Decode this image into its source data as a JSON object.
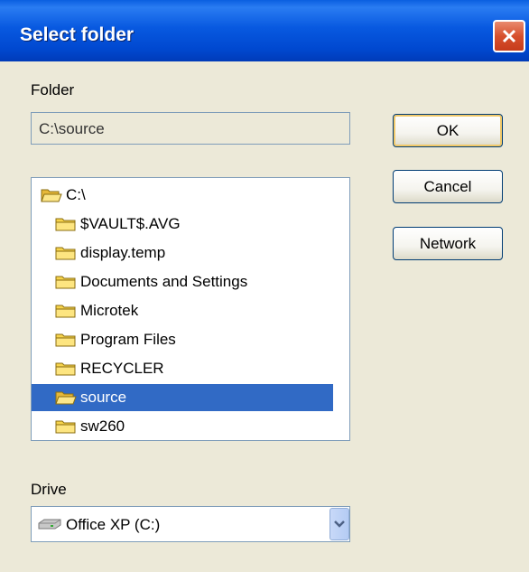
{
  "window": {
    "title": "Select folder"
  },
  "folder": {
    "label": "Folder",
    "value": "C:\\source"
  },
  "buttons": {
    "ok": "OK",
    "cancel": "Cancel",
    "network": "Network"
  },
  "tree": {
    "items": [
      {
        "label": "C:\\",
        "state": "open",
        "selected": false
      },
      {
        "label": "$VAULT$.AVG",
        "state": "closed",
        "selected": false
      },
      {
        "label": "display.temp",
        "state": "closed",
        "selected": false
      },
      {
        "label": "Documents and Settings",
        "state": "closed",
        "selected": false
      },
      {
        "label": "Microtek",
        "state": "closed",
        "selected": false
      },
      {
        "label": "Program Files",
        "state": "closed",
        "selected": false
      },
      {
        "label": "RECYCLER",
        "state": "closed",
        "selected": false
      },
      {
        "label": "source",
        "state": "open",
        "selected": true
      },
      {
        "label": "sw260",
        "state": "closed",
        "selected": false
      }
    ]
  },
  "drive": {
    "label": "Drive",
    "value": "Office XP (C:)"
  },
  "colors": {
    "titlebar": "#0859e0",
    "selection": "#316ac5",
    "dialog_bg": "#ece9d8",
    "close": "#d7502d"
  },
  "icons": {
    "close": "close-icon",
    "folder": "folder-icon",
    "drive": "drive-icon"
  }
}
